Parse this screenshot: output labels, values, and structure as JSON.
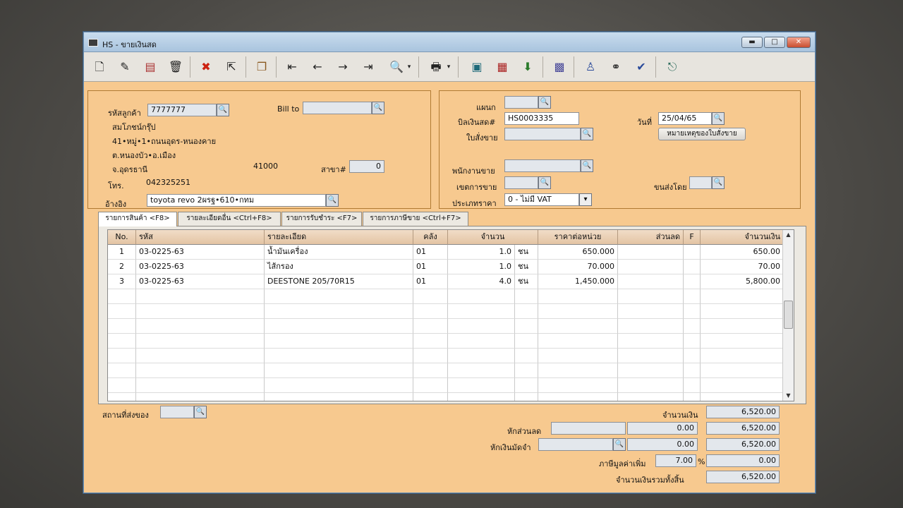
{
  "window": {
    "title": "HS - ขายเงินสด",
    "buttons": {
      "minimize": "▬",
      "maximize": "□",
      "close": "✕"
    }
  },
  "toolbar": {
    "icons": [
      "new-document-icon",
      "edit-icon",
      "delete-icon",
      "trash-icon",
      "cancel-icon",
      "pointer-icon",
      "copy-icon",
      "first-record-icon",
      "previous-record-icon",
      "next-record-icon",
      "last-record-icon",
      "search-icon",
      "print-icon",
      "export-icon",
      "calculator-icon",
      "import-icon",
      "calendar-icon",
      "user-icon",
      "link-icon",
      "ok-icon",
      "exit-icon"
    ]
  },
  "customer": {
    "code_label": "รหัสลูกค้า",
    "code_value": "7777777",
    "name": "สมโภชน์กรุ๊ป",
    "address1": "41•หมู่•1•ถนนอุดร-หนองคาย",
    "address2": "ต.หนองบัว•อ.เมือง",
    "province": "จ.อุดรธานี",
    "postcode": "41000",
    "branch_label": "สาขา#",
    "branch_value": "0",
    "phone_label": "โทร.",
    "phone_value": "042325251",
    "ref_label": "อ้างอิง",
    "ref_value": "toyota revo 2ผรฐ•610•กทม",
    "billto_label": "Bill to",
    "billto_value": ""
  },
  "doc": {
    "dept_label": "แผนก",
    "dept_value": "",
    "bill_label": "บิลเงินสด#",
    "bill_value": "HS0003335",
    "date_label": "วันที่",
    "date_value": "25/04/65",
    "order_label": "ใบสั่งขาย",
    "order_value": "",
    "note_button": "หมายเหตุของใบสั่งขาย",
    "salesman_label": "พนักงานขาย",
    "salesman_value": "",
    "area_label": "เขตการขาย",
    "area_value": "",
    "shipby_label": "ขนส่งโดย",
    "shipby_value": "",
    "pricetype_label": "ประเภทราคา",
    "pricetype_value": "0 - ไม่มี VAT"
  },
  "tabs": [
    "รายการสินค้า <F8>",
    "รายละเอียดอื่น <Ctrl+F8>",
    "รายการรับชำระ <F7>",
    "รายการภาษีขาย <Ctrl+F7>"
  ],
  "grid": {
    "headers": [
      "No.",
      "รหัส",
      "รายละเอียด",
      "คลัง",
      "จำนวน",
      "",
      "ราคาต่อหน่วย",
      "ส่วนลด",
      "F",
      "จำนวนเงิน"
    ],
    "rows": [
      {
        "no": "1",
        "code": "03-0225-63",
        "desc": "น้ำมันเครื่อง",
        "wh": "01",
        "qty": "1.0",
        "unit": "ชน",
        "price": "650.000",
        "disc": "",
        "f": "",
        "amount": "650.00"
      },
      {
        "no": "2",
        "code": "03-0225-63",
        "desc": "ไส้กรอง",
        "wh": "01",
        "qty": "1.0",
        "unit": "ชน",
        "price": "70.000",
        "disc": "",
        "f": "",
        "amount": "70.00"
      },
      {
        "no": "3",
        "code": "03-0225-63",
        "desc": "DEESTONE 205/70R15",
        "wh": "01",
        "qty": "4.0",
        "unit": "ชน",
        "price": "1,450.000",
        "disc": "",
        "f": "",
        "amount": "5,800.00"
      }
    ]
  },
  "footer": {
    "ship_label": "สถานที่ส่งของ",
    "ship_value": "",
    "amount_label": "จำนวนเงิน",
    "amount_value": "6,520.00",
    "discount_label": "หักส่วนลด",
    "discount_input": "",
    "discount_amount": "0.00",
    "after_discount": "6,520.00",
    "deposit_label": "หักเงินมัดจำ",
    "deposit_input": "",
    "deposit_amount": "0.00",
    "after_deposit": "6,520.00",
    "vat_label": "ภาษีมูลค่าเพิ่ม",
    "vat_rate": "7.00",
    "vat_pct": "%",
    "vat_amount": "0.00",
    "total_label": "จำนวนเงินรวมทั้งสิ้น",
    "total_value": "6,520.00"
  }
}
